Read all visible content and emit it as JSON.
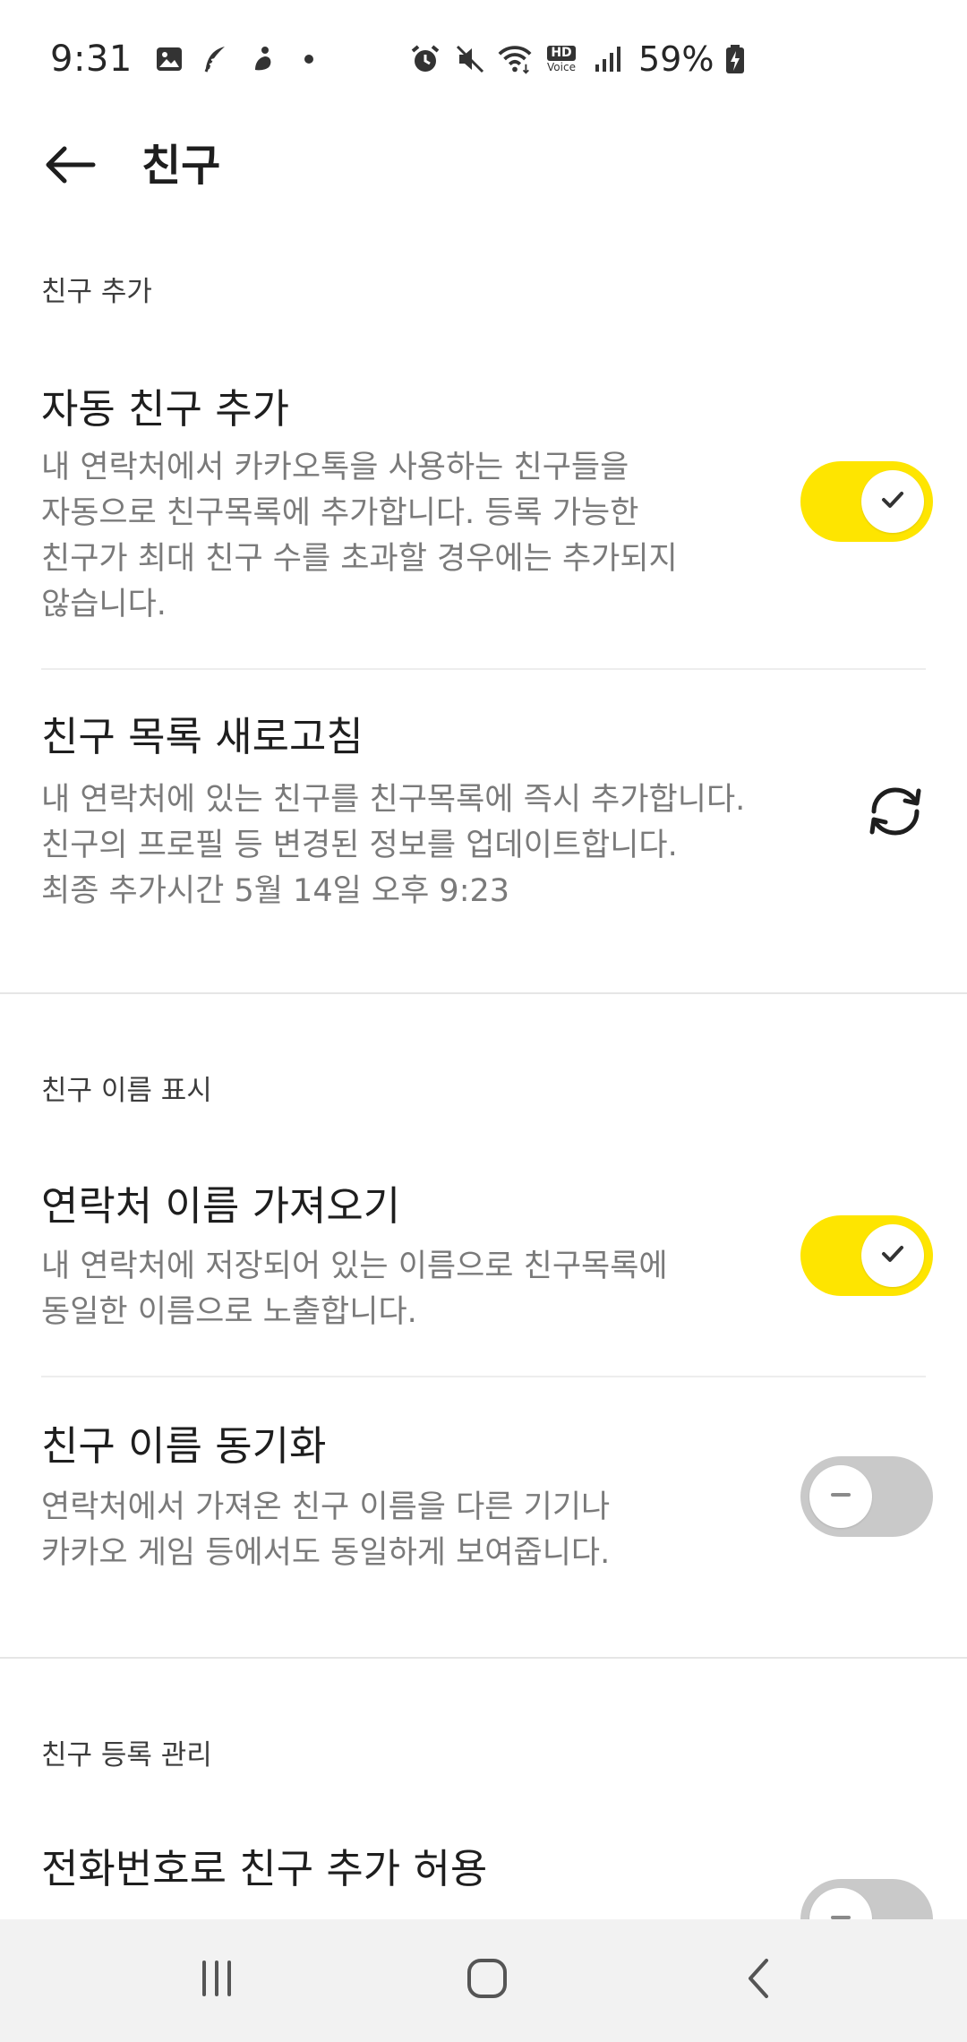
{
  "status_bar": {
    "time": "9:31",
    "battery": "59%",
    "notification_icons": [
      "gallery-icon",
      "feather-icon",
      "runner-icon",
      "dot-icon"
    ],
    "system_icons": [
      "alarm-icon",
      "mute-icon",
      "wifi-icon",
      "hd-voice-icon",
      "signal-icon",
      "battery-icon"
    ],
    "hd_voice_label_top": "HD",
    "hd_voice_label_bottom": "Voice"
  },
  "header": {
    "title": "친구",
    "back_icon": "arrow-left-icon"
  },
  "sections": {
    "add_friends": {
      "header": "친구 추가",
      "auto_add": {
        "title": "자동 친구 추가",
        "description": "내 연락처에서 카카오톡을 사용하는 친구들을\n자동으로 친구목록에 추가합니다. 등록 가능한\n친구가 최대 친구 수를 초과할 경우에는 추가되지\n않습니다.",
        "enabled": true
      },
      "refresh": {
        "title": "친구 목록 새로고침",
        "description": "내 연락처에 있는 친구를 친구목록에 즉시 추가합니다.\n친구의 프로필 등 변경된 정보를 업데이트합니다.\n최종 추가시간 5월 14일 오후 9:23",
        "icon": "refresh-icon"
      }
    },
    "name_display": {
      "header": "친구 이름 표시",
      "import_contact_names": {
        "title": "연락처 이름 가져오기",
        "description": "내 연락처에 저장되어 있는 이름으로 친구목록에\n동일한 이름으로 노출합니다.",
        "enabled": true
      },
      "name_sync": {
        "title": "친구 이름 동기화",
        "description": "연락처에서 가져온 친구 이름을 다른 기기나\n카카오 게임 등에서도 동일하게 보여줍니다.",
        "enabled": false
      }
    },
    "registration": {
      "header": "친구 등록 관리",
      "allow_phone_add": {
        "title": "전화번호로 친구 추가 허용",
        "enabled": false
      }
    }
  },
  "nav_bar": {
    "icons": [
      "recent-apps-icon",
      "home-icon",
      "back-nav-icon"
    ]
  },
  "colors": {
    "toggle_on": "#fee500",
    "toggle_off": "#c9c9c9",
    "nav_bg": "#f2f2f2"
  }
}
